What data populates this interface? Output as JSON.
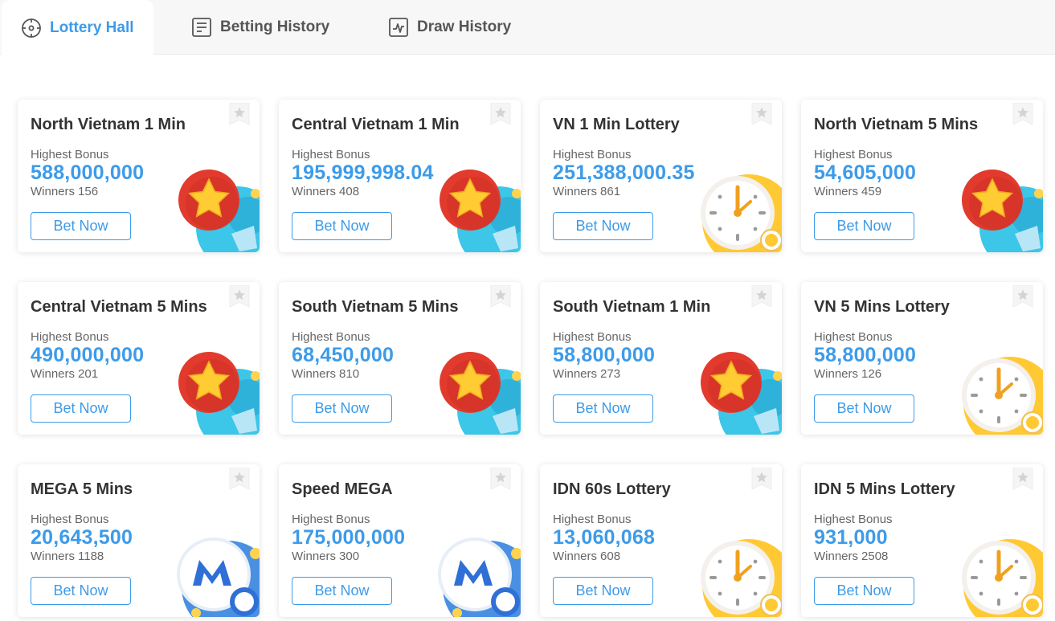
{
  "tabs": [
    {
      "label": "Lottery Hall",
      "icon": "lottery-hall-icon",
      "active": true
    },
    {
      "label": "Betting History",
      "icon": "document-icon",
      "active": false
    },
    {
      "label": "Draw History",
      "icon": "chart-icon",
      "active": false
    }
  ],
  "labels": {
    "highest_bonus": "Highest Bonus",
    "winners": "Winners",
    "bet_now": "Bet Now"
  },
  "colors": {
    "accent": "#3d9be9",
    "star_red": "#e23b2e",
    "star_gold": "#ffcc33"
  },
  "games": [
    {
      "name": "North Vietnam 1 Min",
      "highest_bonus": "588,000,000",
      "winners": "156",
      "art_icon": "star-ball-icon"
    },
    {
      "name": "Central Vietnam 1 Min",
      "highest_bonus": "195,999,998.04",
      "winners": "408",
      "art_icon": "star-ball-icon"
    },
    {
      "name": "VN 1 Min Lottery",
      "highest_bonus": "251,388,000.35",
      "winners": "861",
      "art_icon": "clock-icon"
    },
    {
      "name": "North Vietnam 5 Mins",
      "highest_bonus": "54,605,000",
      "winners": "459",
      "art_icon": "star-ball-icon"
    },
    {
      "name": "Central Vietnam 5 Mins",
      "highest_bonus": "490,000,000",
      "winners": "201",
      "art_icon": "star-ball-icon"
    },
    {
      "name": "South Vietnam 5 Mins",
      "highest_bonus": "68,450,000",
      "winners": "810",
      "art_icon": "star-ball-icon"
    },
    {
      "name": "South Vietnam 1 Min",
      "highest_bonus": "58,800,000",
      "winners": "273",
      "art_icon": "star-ball-icon"
    },
    {
      "name": "VN 5 Mins Lottery",
      "highest_bonus": "58,800,000",
      "winners": "126",
      "art_icon": "clock-icon"
    },
    {
      "name": "MEGA 5 Mins",
      "highest_bonus": "20,643,500",
      "winners": "1188",
      "art_icon": "mega-ball-icon"
    },
    {
      "name": "Speed MEGA",
      "highest_bonus": "175,000,000",
      "winners": "300",
      "art_icon": "mega-ball-icon"
    },
    {
      "name": "IDN 60s Lottery",
      "highest_bonus": "13,060,068",
      "winners": "608",
      "art_icon": "clock-icon"
    },
    {
      "name": "IDN 5 Mins Lottery",
      "highest_bonus": "931,000",
      "winners": "2508",
      "art_icon": "clock-icon"
    }
  ]
}
